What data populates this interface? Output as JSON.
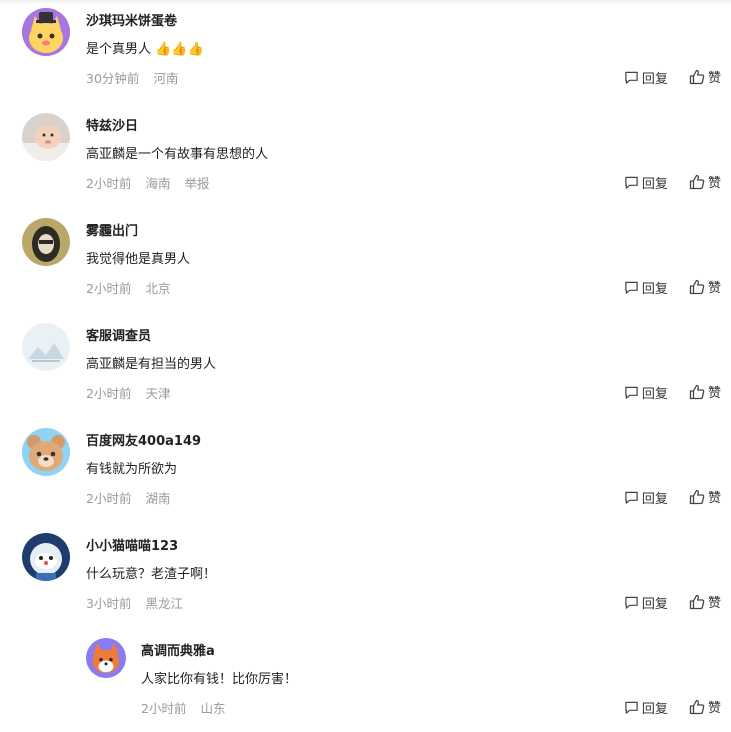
{
  "comments": [
    {
      "name": "沙琪玛米饼蛋卷",
      "text": "是个真男人",
      "emoji": "👍👍👍",
      "time": "30分钟前",
      "location": "河南",
      "report": ""
    },
    {
      "name": "特兹沙日",
      "text": "高亚麟是一个有故事有思想的人",
      "emoji": "",
      "time": "2小时前",
      "location": "海南",
      "report": "举报"
    },
    {
      "name": "雾霾出门",
      "text": "我觉得他是真男人",
      "emoji": "",
      "time": "2小时前",
      "location": "北京",
      "report": ""
    },
    {
      "name": "客服调查员",
      "text": "高亚麟是有担当的男人",
      "emoji": "",
      "time": "2小时前",
      "location": "天津",
      "report": ""
    },
    {
      "name": "百度网友400a149",
      "text": "有钱就为所欲为",
      "emoji": "",
      "time": "2小时前",
      "location": "湖南",
      "report": ""
    },
    {
      "name": "小小猫喵喵123",
      "text": "什么玩意？老渣子啊！",
      "emoji": "",
      "time": "3小时前",
      "location": "黑龙江",
      "report": ""
    },
    {
      "name": "高调而典雅a",
      "text": "人家比你有钱！比你厉害！",
      "emoji": "",
      "time": "2小时前",
      "location": "山东",
      "report": ""
    }
  ],
  "actions": {
    "reply": "回复",
    "like": "赞"
  },
  "icons": {
    "reply": "comment-bubble-icon",
    "like": "thumbs-up-icon"
  }
}
